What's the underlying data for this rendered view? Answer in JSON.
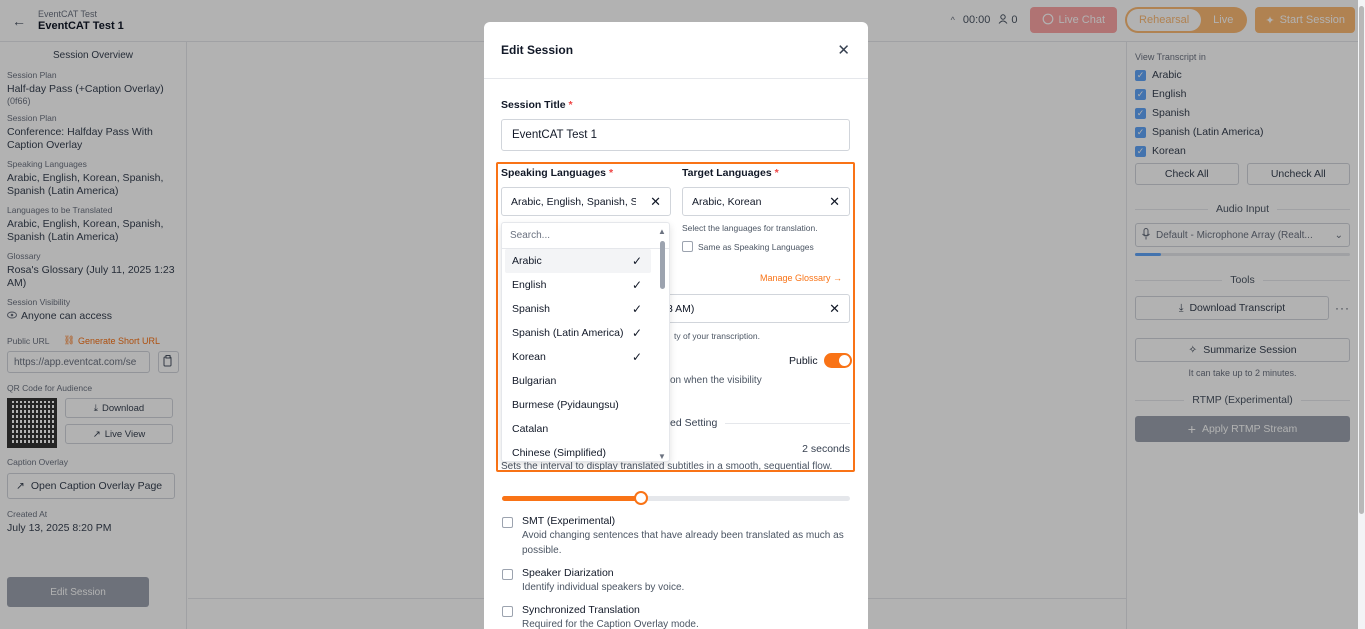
{
  "header": {
    "crumb_parent": "EventCAT Test",
    "crumb_current": "EventCAT Test 1",
    "timer": "00:00",
    "users_count": "0",
    "live_chat_label": "Live Chat",
    "mode_rehearsal": "Rehearsal",
    "mode_live": "Live",
    "start_session_label": "Start Session"
  },
  "sidebar": {
    "title": "Session Overview",
    "plan_label": "Session Plan",
    "plan_value": "Half-day Pass (+Caption Overlay)",
    "plan_code": "(0f66)",
    "plan2_label": "Session Plan",
    "plan2_value": "Conference: Halfday Pass With Caption Overlay",
    "speaking_label": "Speaking Languages",
    "speaking_value": "Arabic, English, Korean, Spanish, Spanish (Latin America)",
    "translated_label": "Languages to be Translated",
    "translated_value": "Arabic, English, Korean, Spanish, Spanish (Latin America)",
    "glossary_label": "Glossary",
    "glossary_value": "Rosa's Glossary (July 11, 2025 1:23 AM)",
    "visibility_label": "Session Visibility",
    "visibility_value": "Anyone can access",
    "public_url_label": "Public URL",
    "generate_short_url": "Generate Short URL",
    "public_url_value": "https://app.eventcat.com/se",
    "qr_label": "QR Code for Audience",
    "download_label": "Download",
    "live_view_label": "Live View",
    "caption_overlay_label": "Caption Overlay",
    "open_overlay_label": "Open Caption Overlay Page",
    "created_label": "Created At",
    "created_value": "July 13, 2025 8:20 PM",
    "edit_session_label": "Edit Session"
  },
  "right_panel": {
    "view_transcript_label": "View Transcript in",
    "languages": [
      "Arabic",
      "English",
      "Spanish",
      "Spanish (Latin America)",
      "Korean"
    ],
    "check_all": "Check All",
    "uncheck_all": "Uncheck All",
    "audio_input_title": "Audio Input",
    "audio_device": "Default - Microphone Array (Realt...",
    "tools_title": "Tools",
    "download_transcript": "Download Transcript",
    "summarize_session": "Summarize Session",
    "summarize_note": "It can take up to 2 minutes.",
    "rtmp_title": "RTMP (Experimental)",
    "apply_rtmp": "Apply RTMP Stream"
  },
  "modal": {
    "title": "Edit Session",
    "session_title_label": "Session Title",
    "session_title_value": "EventCAT Test 1",
    "speaking_label": "Speaking Languages",
    "speaking_value": "Arabic, English, Spanish, Sp",
    "target_label": "Target Languages",
    "target_value": "Arabic, Korean",
    "target_hint": "Select the languages for translation.",
    "same_as_speaking": "Same as Speaking Languages",
    "manage_glossary": "Manage Glossary →",
    "glossary_fragment": "3 AM)",
    "glossary_hint_fragment": "ty of your transcription.",
    "public_label": "Public",
    "visibility_fragment": "on when the visibility",
    "advanced_fragment": "ed Setting",
    "interval_value": "2 seconds",
    "interval_desc": "Sets the interval to display translated subtitles in a smooth, sequential flow.",
    "interval_fraction": 0.4,
    "options": [
      {
        "title": "SMT (Experimental)",
        "desc": "Avoid changing sentences that have already been translated as much as possible."
      },
      {
        "title": "Speaker Diarization",
        "desc": "Identify individual speakers by voice."
      },
      {
        "title": "Synchronized Translation",
        "desc": "Required for the Caption Overlay mode."
      }
    ]
  },
  "dropdown": {
    "search_placeholder": "Search...",
    "items": [
      {
        "label": "Arabic",
        "checked": true
      },
      {
        "label": "English",
        "checked": true
      },
      {
        "label": "Spanish",
        "checked": true
      },
      {
        "label": "Spanish (Latin America)",
        "checked": true
      },
      {
        "label": "Korean",
        "checked": true
      },
      {
        "label": "Bulgarian",
        "checked": false
      },
      {
        "label": "Burmese (Pyidaungsu)",
        "checked": false
      },
      {
        "label": "Catalan",
        "checked": false
      },
      {
        "label": "Chinese (Simplified)",
        "checked": false
      }
    ]
  },
  "colors": {
    "accent": "#f97316",
    "checkbox": "#60a5fa"
  }
}
